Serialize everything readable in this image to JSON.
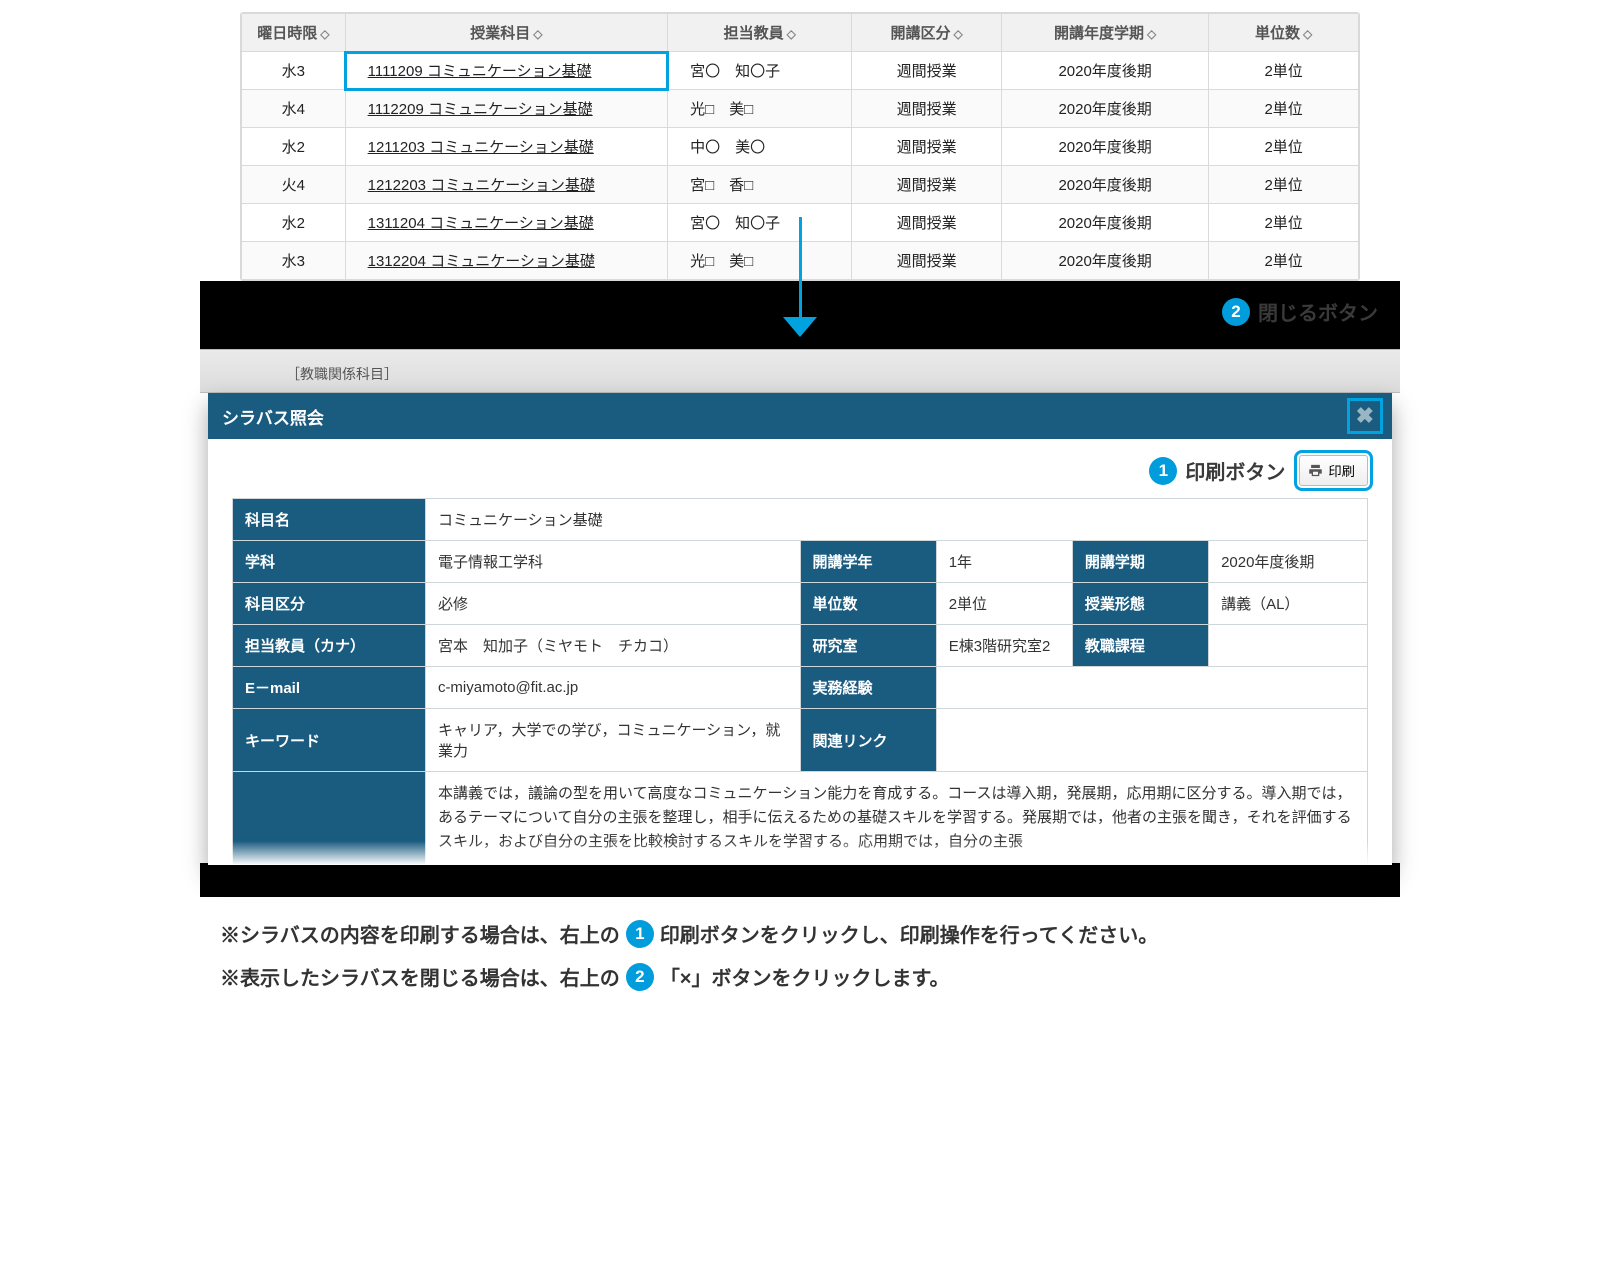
{
  "course_table": {
    "headers": {
      "day": "曜日時限",
      "subject": "授業科目",
      "instructor": "担当教員",
      "category": "開講区分",
      "term": "開講年度学期",
      "credits": "単位数"
    },
    "rows": [
      {
        "day": "水3",
        "subject": "1111209 コミュニケーション基礎",
        "instructor": "宮〇　知〇子",
        "category": "週間授業",
        "term": "2020年度後期",
        "credits": "2単位"
      },
      {
        "day": "水4",
        "subject": "1112209 コミュニケーション基礎",
        "instructor": "光□　美□",
        "category": "週間授業",
        "term": "2020年度後期",
        "credits": "2単位"
      },
      {
        "day": "水2",
        "subject": "1211203 コミュニケーション基礎",
        "instructor": "中〇　美〇",
        "category": "週間授業",
        "term": "2020年度後期",
        "credits": "2単位"
      },
      {
        "day": "火4",
        "subject": "1212203 コミュニケーション基礎",
        "instructor": "宮□　香□",
        "category": "週間授業",
        "term": "2020年度後期",
        "credits": "2単位"
      },
      {
        "day": "水2",
        "subject": "1311204 コミュニケーション基礎",
        "instructor": "宮〇　知〇子",
        "category": "週間授業",
        "term": "2020年度後期",
        "credits": "2単位"
      },
      {
        "day": "水3",
        "subject": "1312204 コミュニケーション基礎",
        "instructor": "光□　美□",
        "category": "週間授業",
        "term": "2020年度後期",
        "credits": "2単位"
      }
    ]
  },
  "annotations": {
    "close_button": "閉じるボタン",
    "print_button": "印刷ボタン"
  },
  "syllabus": {
    "window_title": "シラバス照会",
    "behind_band_text": "［教職関係科目］",
    "print_label": "印刷",
    "fields": {
      "subject_name_k": "科目名",
      "subject_name_v": "コミュニケーション基礎",
      "department_k": "学科",
      "department_v": "電子情報工学科",
      "grade_k": "開講学年",
      "grade_v": "1年",
      "semester_k": "開講学期",
      "semester_v": "2020年度後期",
      "subj_cat_k": "科目区分",
      "subj_cat_v": "必修",
      "credits_k": "単位数",
      "credits_v": "2単位",
      "classform_k": "授業形態",
      "classform_v": "講義（AL）",
      "instr_kana_k": "担当教員（カナ）",
      "instr_kana_v": "宮本　知加子（ミヤモト　チカコ）",
      "room_k": "研究室",
      "room_v": "E棟3階研究室2",
      "teacher_course_k": "教職課程",
      "teacher_course_v": "",
      "email_k": "E－mail",
      "email_v": "c-miyamoto@fit.ac.jp",
      "practice_k": "実務経験",
      "practice_v": "",
      "keyword_k": "キーワード",
      "keyword_v": "キャリア，大学での学び，コミュニケーション，就業力",
      "link_k": "関連リンク",
      "link_v": "",
      "description": "本講義では，議論の型を用いて高度なコミュニケーション能力を育成する。コースは導入期，発展期，応用期に区分する。導入期では，あるテーマについて自分の主張を整理し，相手に伝えるための基礎スキルを学習する。発展期では，他者の主張を聞き，それを評価するスキル，および自分の主張を比較検討するスキルを学習する。応用期では，自分の主張"
    }
  },
  "footnotes": {
    "line1_pre": "※シラバスの内容を印刷する場合は、右上の",
    "line1_mid": "印刷ボタンをクリックし、印刷操作を行ってください。",
    "line2_pre": "※表示したシラバスを閉じる場合は、右上の",
    "line2_mid": "「×」ボタンをクリックします。"
  }
}
